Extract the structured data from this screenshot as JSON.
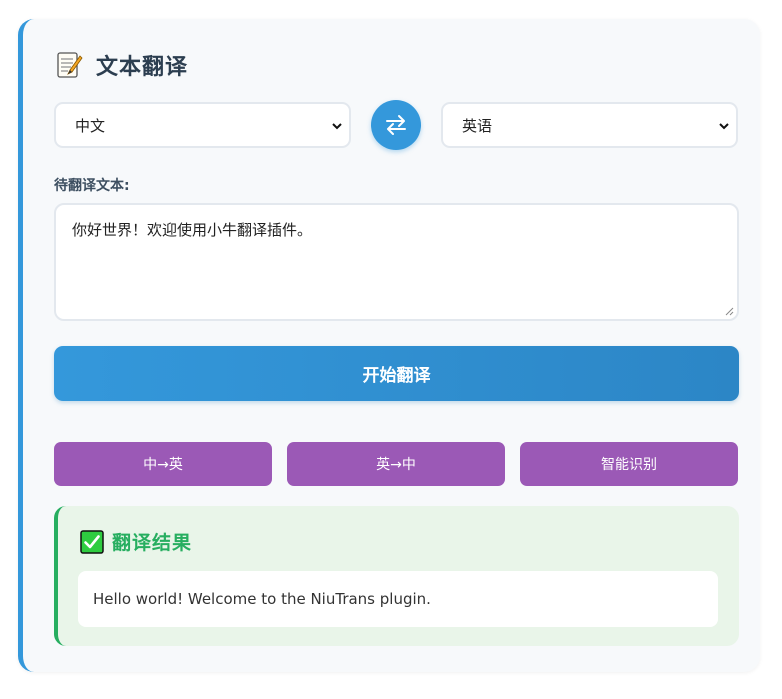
{
  "header": {
    "title": "文本翻译",
    "icon": "memo-icon"
  },
  "languages": {
    "source": "中文",
    "target": "英语",
    "swap_icon": "swap-arrows-icon"
  },
  "input": {
    "label": "待翻译文本:",
    "value": "你好世界！欢迎使用小牛翻译插件。"
  },
  "actions": {
    "translate_label": "开始翻译"
  },
  "quick_buttons": [
    {
      "label": "中→英"
    },
    {
      "label": "英→中"
    },
    {
      "label": "智能识别"
    }
  ],
  "result": {
    "icon": "check-mark-icon",
    "title": "翻译结果",
    "text": "Hello world! Welcome to the NiuTrans plugin."
  },
  "colors": {
    "accent_blue": "#3498db",
    "quick_purple": "#9b59b6",
    "success_green": "#27ae60"
  }
}
